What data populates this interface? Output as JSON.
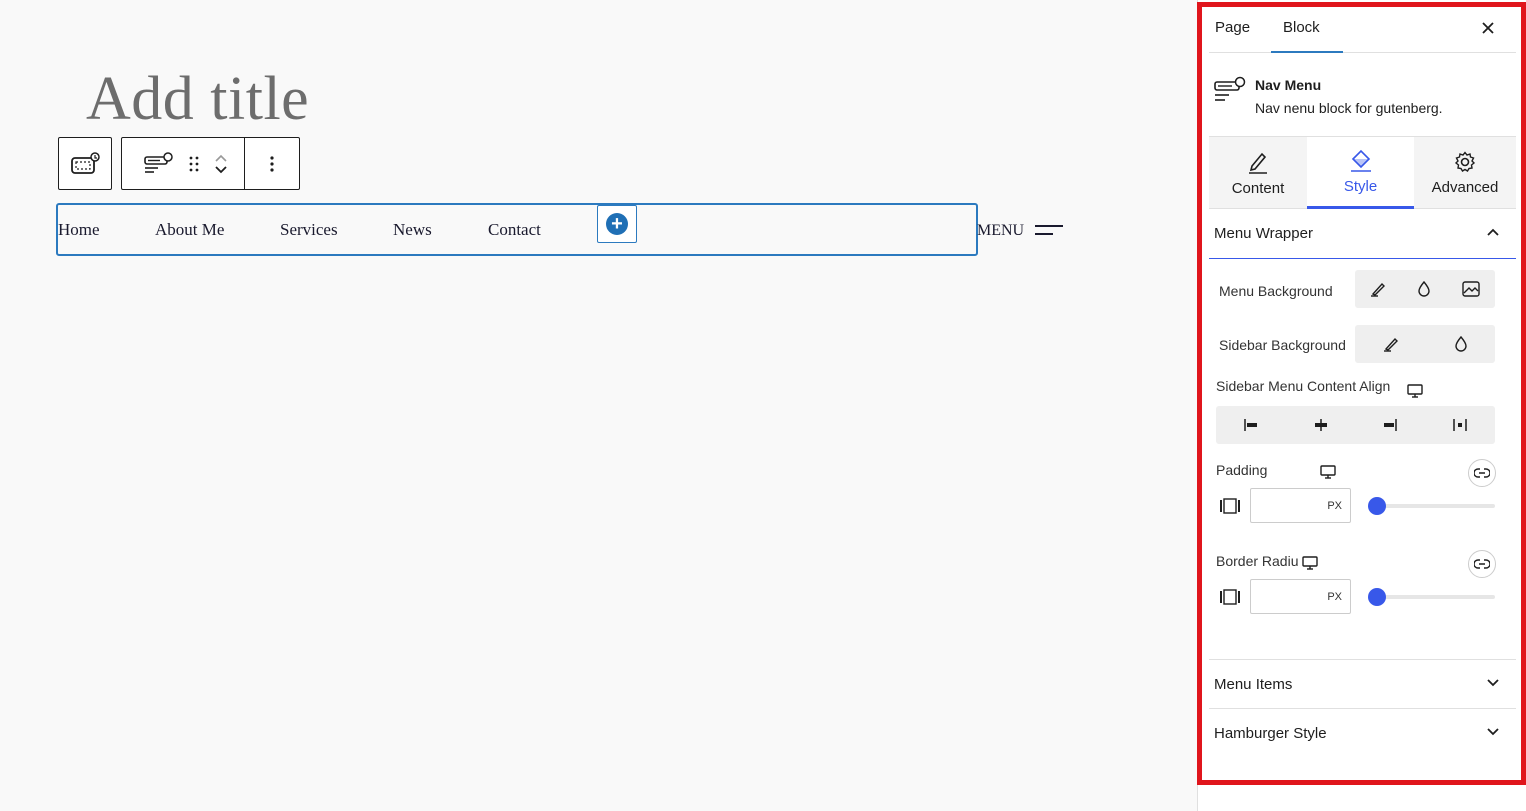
{
  "editor": {
    "title_placeholder": "Add title",
    "nav_items": [
      "Home",
      "About Me",
      "Services",
      "News",
      "Contact"
    ],
    "menu_toggle_label": "MENU"
  },
  "sidebar": {
    "tabs": {
      "page": "Page",
      "block": "Block"
    },
    "block_info": {
      "title": "Nav Menu",
      "description": "Nav nenu block for gutenberg."
    },
    "panel_tabs": {
      "content": "Content",
      "style": "Style",
      "advanced": "Advanced"
    },
    "menu_wrapper": {
      "title": "Menu Wrapper",
      "menu_background": "Menu Background",
      "sidebar_background": "Sidebar Background",
      "sidebar_align": "Sidebar Menu Content Align",
      "padding": "Padding",
      "padding_unit": "PX",
      "border_radius": "Border Radiu",
      "radius_unit": "PX"
    },
    "menu_items": "Menu Items",
    "hamburger_style": "Hamburger Style"
  },
  "colors": {
    "accent": "#3858e9",
    "highlight_border": "#e0151c",
    "nav_border": "#2c7abf"
  }
}
